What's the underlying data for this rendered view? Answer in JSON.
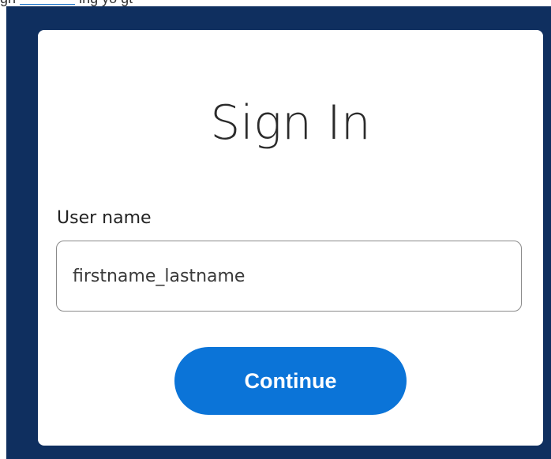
{
  "top_fragment": {
    "before": "gh",
    "link": "",
    "after": "ing yo  gt"
  },
  "signin": {
    "title": "Sign In",
    "username_label": "User name",
    "username_placeholder": "firstname_lastname",
    "continue_label": "Continue"
  },
  "colors": {
    "backdrop": "#0f2f5f",
    "card": "#ffffff",
    "button": "#0b74d8",
    "link": "#1a73c9"
  }
}
